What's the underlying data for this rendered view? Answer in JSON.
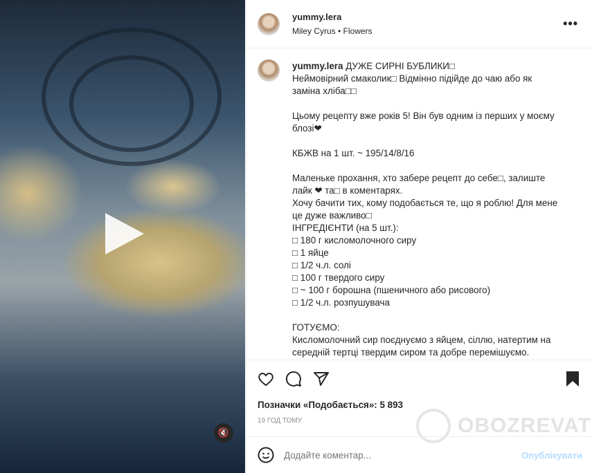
{
  "post": {
    "username": "yummy.lera",
    "audio": "Miley Cyrus • Flowers",
    "more_label": "•••",
    "caption_title": "ДУЖЕ СИРНІ БУБЛИКИ□",
    "caption_lines": [
      "Неймовірний смаколик□ Відмінно підійде до чаю або як",
      "заміна хліба□□",
      "",
      "Цьому рецепту вже років 5! Він був одним із перших у моєму",
      "блозі❤",
      "",
      "КБЖВ на 1 шт. ~ 195/14/8/16",
      "",
      "Маленьке прохання, хто забере рецепт до себе□, залиште",
      "лайк ❤ та□ в коментарях.",
      "Хочу бачити тих, кому подобається те, що я роблю! Для мене",
      "це дуже важливо□",
      "ІНГРЕДІЄНТИ (на 5 шт.):",
      "□ 180 г кисломолочного сиру",
      "□ 1 яйце",
      "□ 1/2 ч.л. солі",
      "□ 100 г твердого сиру",
      "□ ~ 100 г борошна (пшеничного або рисового)",
      "□ 1/2 ч.л. розпушувача",
      "",
      "ГОТУЄМО:",
      "Кисломолочний сир поєднуємо з яйцем, сіллю, натертим на",
      "середній тертці твердим сиром та добре перемішуємо."
    ],
    "likes": "Позначки «Подобається»: 5 893",
    "time": "19 ГОД ТОМУ",
    "comment_placeholder": "Додайте коментар...",
    "publish_label": "Опублікувати",
    "watermark": "OBOZREVATEL",
    "mute_icon": "🔇"
  },
  "colors": {
    "publish": "#b3dbff",
    "text": "#262626",
    "secondary": "#8e8e8e"
  }
}
